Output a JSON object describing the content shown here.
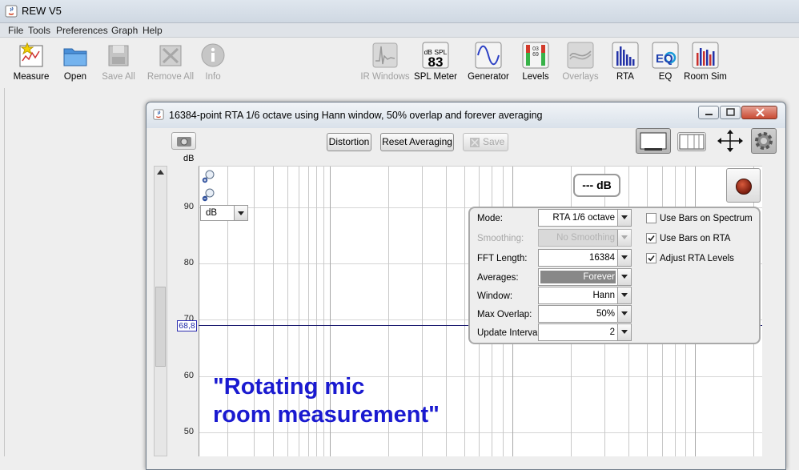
{
  "app": {
    "title": "REW V5"
  },
  "menu": [
    "File",
    "Tools",
    "Preferences",
    "Graph",
    "Help"
  ],
  "toolbar": {
    "left": [
      {
        "label": "Measure",
        "icon": "measure-icon",
        "enabled": true
      },
      {
        "label": "Open",
        "icon": "folder-open-icon",
        "enabled": true
      },
      {
        "label": "Save All",
        "icon": "save-all-icon",
        "enabled": false
      },
      {
        "label": "Remove All",
        "icon": "remove-all-icon",
        "enabled": false
      },
      {
        "label": "Info",
        "icon": "info-icon",
        "enabled": false
      }
    ],
    "right": [
      {
        "label": "IR Windows",
        "icon": "ir-windows-icon",
        "enabled": false
      },
      {
        "label": "SPL Meter",
        "icon": "spl-meter-icon",
        "enabled": true
      },
      {
        "label": "Generator",
        "icon": "generator-icon",
        "enabled": true
      },
      {
        "label": "Levels",
        "icon": "levels-icon",
        "enabled": true
      },
      {
        "label": "Overlays",
        "icon": "overlays-icon",
        "enabled": false
      },
      {
        "label": "RTA",
        "icon": "rta-icon",
        "enabled": true
      },
      {
        "label": "EQ",
        "icon": "eq-icon",
        "enabled": true
      },
      {
        "label": "Room Sim",
        "icon": "room-sim-icon",
        "enabled": true
      }
    ],
    "spl_icon_top": "dB SPL",
    "spl_icon_value": "83",
    "eq_icon_text": "EQ",
    "levels_icon_text": "0369"
  },
  "rta_window": {
    "title": "16384-point RTA 1/6 octave using Hann window, 50% overlap and forever averaging",
    "buttons": {
      "distortion": "Distortion",
      "reset_averaging": "Reset Averaging",
      "save": "Save"
    },
    "y_unit_label": "dB",
    "unit_select": "dB",
    "y_ticks": [
      "90",
      "80",
      "70",
      "60",
      "50"
    ],
    "marker_value": "68,8",
    "level_readout": "--- dB",
    "annotation": "\"Rotating mic\nroom measurement\""
  },
  "settings": {
    "rows": [
      {
        "label": "Mode:",
        "value": "RTA 1/6 octave",
        "state": "normal"
      },
      {
        "label": "Smoothing:",
        "value": "No Smoothing",
        "state": "disabled"
      },
      {
        "label": "FFT Length:",
        "value": "16384",
        "state": "normal"
      },
      {
        "label": "Averages:",
        "value": "Forever",
        "state": "shaded"
      },
      {
        "label": "Window:",
        "value": "Hann",
        "state": "normal"
      },
      {
        "label": "Max Overlap:",
        "value": "50%",
        "state": "normal"
      },
      {
        "label": "Update Interval:",
        "value": "2",
        "state": "normal"
      }
    ],
    "checkboxes": [
      {
        "label": "Use Bars on Spectrum",
        "checked": false
      },
      {
        "label": "Use Bars on RTA",
        "checked": true
      },
      {
        "label": "Adjust RTA Levels",
        "checked": true
      }
    ]
  },
  "colors": {
    "annotation": "#1a1ad0",
    "trace": "#17176e",
    "record": "#b8341b"
  }
}
